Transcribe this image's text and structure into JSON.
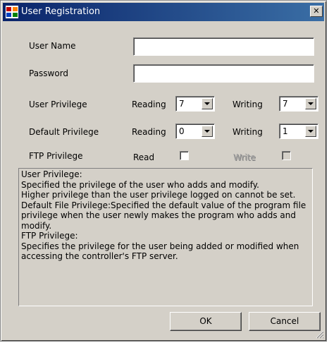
{
  "window": {
    "title": "User Registration",
    "close_glyph": "✕"
  },
  "form": {
    "user_name_label": "User Name",
    "user_name_value": "",
    "password_label": "Password",
    "password_value": "",
    "user_privilege_label": "User Privilege",
    "user_privilege": {
      "reading_label": "Reading",
      "reading_value": "7",
      "writing_label": "Writing",
      "writing_value": "7"
    },
    "default_privilege_label": "Default Privilege",
    "default_privilege": {
      "reading_label": "Reading",
      "reading_value": "0",
      "writing_label": "Writing",
      "writing_value": "1"
    },
    "ftp_privilege_label": "FTP Privilege",
    "ftp": {
      "read_label": "Read",
      "read_checked": false,
      "write_label": "Write",
      "write_checked": false,
      "write_enabled": false
    }
  },
  "info_lines": [
    "User Privilege:",
    "Specified the privilege of the user who adds and modify.",
    "Higher privilege than the user privilege logged on cannot be set.",
    "Default File Privilege:Specified the default value of the program file privilege when the user newly makes the program who adds and modify.",
    "FTP Privilege:",
    "Specifies the privilege for the user being added or modified when accessing the controller's FTP server."
  ],
  "buttons": {
    "ok": "OK",
    "cancel": "Cancel"
  },
  "colors": {
    "title_bar_start": "#0a246a",
    "title_bar_end": "#3a6ea5",
    "dialog_face": "#d4d0c8"
  }
}
